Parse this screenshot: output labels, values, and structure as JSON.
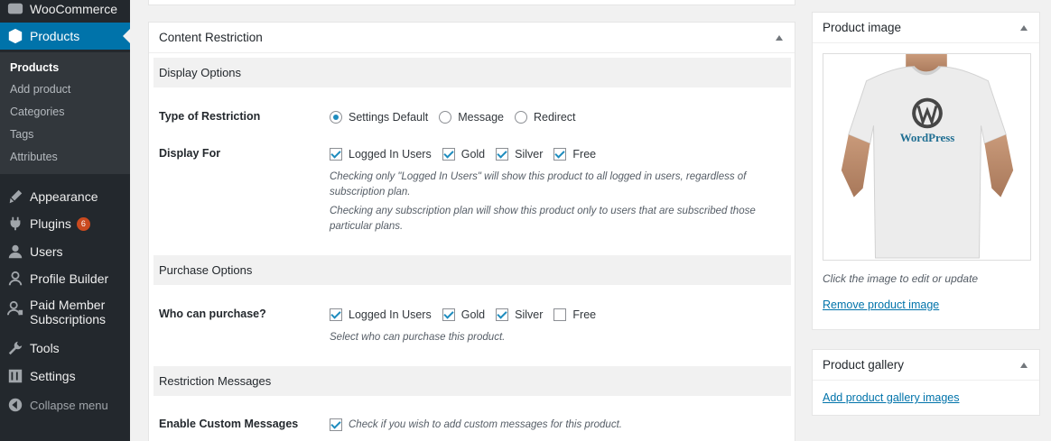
{
  "sidebar": {
    "woocommerce_label": "WooCommerce",
    "products_label": "Products",
    "submenu": [
      "Products",
      "Add product",
      "Categories",
      "Tags",
      "Attributes"
    ],
    "appearance_label": "Appearance",
    "plugins_label": "Plugins",
    "plugins_badge": "6",
    "users_label": "Users",
    "profile_builder_label": "Profile Builder",
    "pms_label_1": "Paid Member",
    "pms_label_2": "Subscriptions",
    "tools_label": "Tools",
    "settings_label": "Settings",
    "collapse_label": "Collapse menu"
  },
  "content_restriction": {
    "title": "Content Restriction",
    "display_options_title": "Display Options",
    "type_label": "Type of Restriction",
    "type_options": [
      "Settings Default",
      "Message",
      "Redirect"
    ],
    "display_for_label": "Display For",
    "display_for_options": [
      "Logged In Users",
      "Gold",
      "Silver",
      "Free"
    ],
    "display_desc_1": "Checking only \"Logged In Users\" will show this product to all logged in users, regardless of subscription plan.",
    "display_desc_2": "Checking any subscription plan will show this product only to users that are subscribed those particular plans.",
    "purchase_options_title": "Purchase Options",
    "who_label": "Who can purchase?",
    "who_options": [
      "Logged In Users",
      "Gold",
      "Silver",
      "Free"
    ],
    "who_desc": "Select who can purchase this product.",
    "restriction_messages_title": "Restriction Messages",
    "custom_label": "Enable Custom Messages",
    "custom_desc": "Check if you wish to add custom messages for this product."
  },
  "product_image": {
    "title": "Product image",
    "hint": "Click the image to edit or update",
    "remove_link": "Remove product image",
    "shirt_text": "WordPress"
  },
  "product_gallery": {
    "title": "Product gallery",
    "add_link": "Add product gallery images"
  },
  "colors": {
    "accent": "#0073aa",
    "sidebar_bg": "#23282d",
    "badge": "#ca4a1f"
  }
}
